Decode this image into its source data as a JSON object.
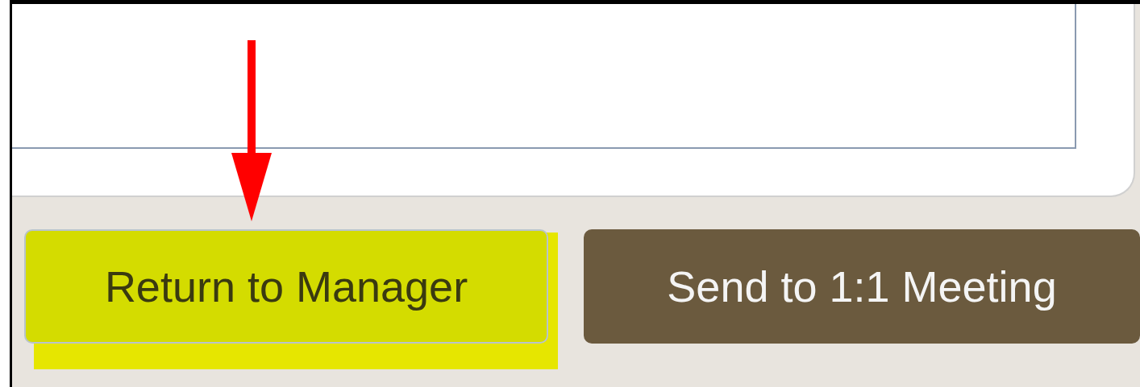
{
  "buttons": [
    {
      "label": "Return to Manager",
      "kind": "secondary",
      "highlighted": true
    },
    {
      "label": "Send to 1:1 Meeting",
      "kind": "primary",
      "highlighted": false
    }
  ]
}
